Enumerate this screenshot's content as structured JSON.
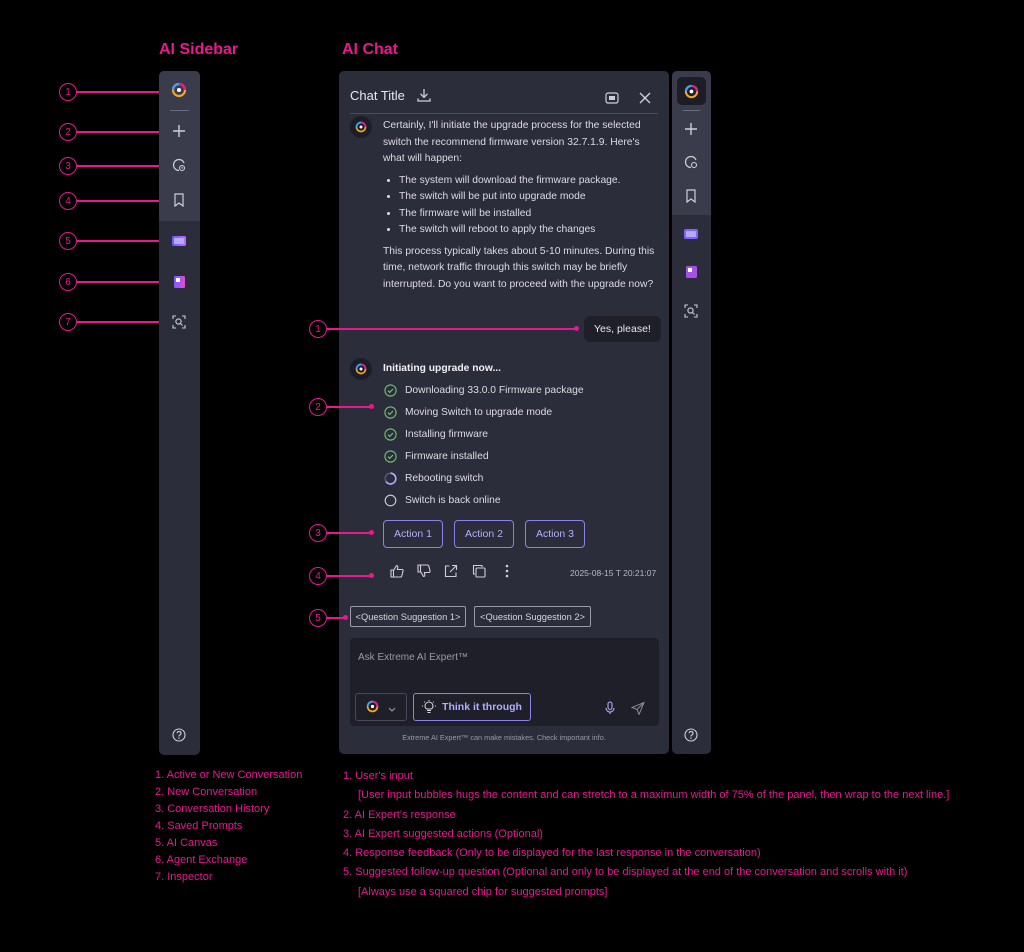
{
  "headings": {
    "sidebar": "AI Sidebar",
    "chat": "AI Chat"
  },
  "chat": {
    "title": "Chat Title",
    "ai_message": {
      "intro": "Certainly, I'll initiate the upgrade process for the selected switch the recommend firmware version 32.7.1.9. Here's what will happen:",
      "bullets": [
        "The system will download the firmware package.",
        "The switch will be put into upgrade mode",
        "The firmware will be installed",
        "The switch will reboot to apply the changes"
      ],
      "outro": "This process typically takes about 5-10 minutes. During this time, network traffic through this switch may be briefly interrupted. Do you want to proceed with the upgrade now?"
    },
    "user_message": "Yes, please!",
    "progress": {
      "title": "Initiating upgrade now...",
      "steps": [
        {
          "label": "Downloading 33.0.0 Firmware package",
          "status": "done"
        },
        {
          "label": "Moving Switch to upgrade mode",
          "status": "done"
        },
        {
          "label": "Installing firmware",
          "status": "done"
        },
        {
          "label": "Firmware installed",
          "status": "done"
        },
        {
          "label": "Rebooting switch",
          "status": "in-progress"
        },
        {
          "label": "Switch is back online",
          "status": "pending"
        }
      ]
    },
    "actions": [
      "Action 1",
      "Action 2",
      "Action 3"
    ],
    "timestamp": "2025-08-15 T 20:21:07",
    "suggestions": [
      "<Question Suggestion 1>",
      "<Question Suggestion 2>"
    ],
    "input": {
      "placeholder": "Ask Extreme AI Expert™",
      "think_label": "Think it through",
      "disclaimer": "Extreme AI Expert™ can make mistakes. Check important info."
    }
  },
  "annotations": {
    "sidebar": [
      "1",
      "2",
      "3",
      "4",
      "5",
      "6",
      "7"
    ],
    "chat": [
      "1",
      "2",
      "3",
      "4",
      "5"
    ]
  },
  "legend_sidebar": [
    "1. Active or New Conversation",
    "2. New Conversation",
    "3. Conversation History",
    "4. Saved Prompts",
    "5. AI Canvas",
    "6. Agent Exchange",
    "7. Inspector"
  ],
  "legend_chat": [
    "1. User's input",
    "[User input bubbles hugs the content and can stretch to a maximum width of 75% of the panel, then wrap to the next line.]",
    "2. AI Expert's response",
    "3. AI Expert suggested actions (Optional)",
    "4. Response feedback (Only to be displayed for the last response in the conversation)",
    "5. Suggested follow-up question (Optional and only to be displayed at the end of the conversation and scrolls with it)",
    "[Always use a squared chip for suggested prompts]"
  ],
  "colors": {
    "accent": "#e8188f",
    "action": "#8b83e8",
    "success": "#6fc36f",
    "panel": "#2c2d3a"
  }
}
